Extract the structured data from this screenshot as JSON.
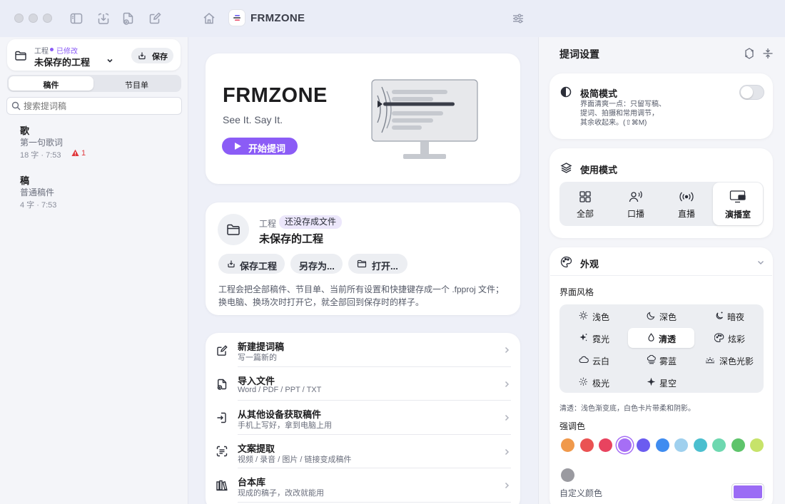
{
  "app": {
    "title": "FRMZONE"
  },
  "project": {
    "label": "工程",
    "status": "已修改",
    "name": "未保存的工程",
    "save_label": "保存"
  },
  "sidebar": {
    "tabs": [
      "稿件",
      "节目单"
    ],
    "search_placeholder": "搜索提词稿",
    "documents": [
      {
        "title": "歌",
        "subtitle": "第一句歌词",
        "meta": "18 字 · 7:53",
        "warning": "1"
      },
      {
        "title": "稿",
        "subtitle": "普通稿件",
        "meta": "4 字 · 7:53"
      }
    ]
  },
  "hero": {
    "brand": "FRMZONE",
    "slogan": "See It. Say It.",
    "start_label": "开始提词"
  },
  "project_card": {
    "label": "工程",
    "badge": "还没存成文件",
    "name": "未保存的工程",
    "buttons": [
      "保存工程",
      "另存为...",
      "打开..."
    ],
    "description": "工程会把全部稿件、节目单、当前所有设置和快捷键存成一个 .fpproj 文件；换电脑、换场次时打开它，就全部回到保存时的样子。"
  },
  "actions": [
    {
      "title": "新建提词稿",
      "subtitle": "写一篇新的",
      "icon": "compose-icon"
    },
    {
      "title": "导入文件",
      "subtitle": "Word / PDF / PPT / TXT",
      "icon": "import-file-icon"
    },
    {
      "title": "从其他设备获取稿件",
      "subtitle": "手机上写好，拿到电脑上用",
      "icon": "receive-icon"
    },
    {
      "title": "文案提取",
      "subtitle": "视频 / 录音 / 图片 / 链接变成稿件",
      "icon": "extract-text-icon"
    },
    {
      "title": "台本库",
      "subtitle": "现成的稿子，改改就能用",
      "icon": "library-icon"
    }
  ],
  "right_panel": {
    "title": "提词设置",
    "minimal": {
      "title": "极简模式",
      "description": [
        "界面清爽一点：只留写稿、",
        "提词、拍摄和常用调节，",
        "其余收起来。(⇧⌘M)"
      ],
      "enabled": false
    },
    "usage": {
      "title": "使用模式",
      "modes": [
        "全部",
        "口播",
        "直播",
        "演播室"
      ],
      "selected": "演播室"
    },
    "appearance": {
      "title": "外观",
      "style_label": "界面风格",
      "themes": [
        "浅色",
        "深色",
        "暗夜",
        "霓光",
        "清透",
        "炫彩",
        "云白",
        "雾蓝",
        "深色光影",
        "极光",
        "星空"
      ],
      "selected_theme": "清透",
      "theme_note": "清透：浅色渐变底，白色卡片带柔和阴影。",
      "accent_label": "强调色",
      "accent_colors": [
        "#f0994b",
        "#ea5252",
        "#e8435f",
        "#a66ef5",
        "#6b5cf0",
        "#3f8cf0",
        "#9fd0ee",
        "#4bbfcf",
        "#6ed8b0",
        "#5ec46b",
        "#c7e36a",
        "#9a9aa0"
      ],
      "selected_accent": "#a66ef5",
      "custom_label": "自定义颜色",
      "custom_color": "#9b6cf5"
    }
  }
}
